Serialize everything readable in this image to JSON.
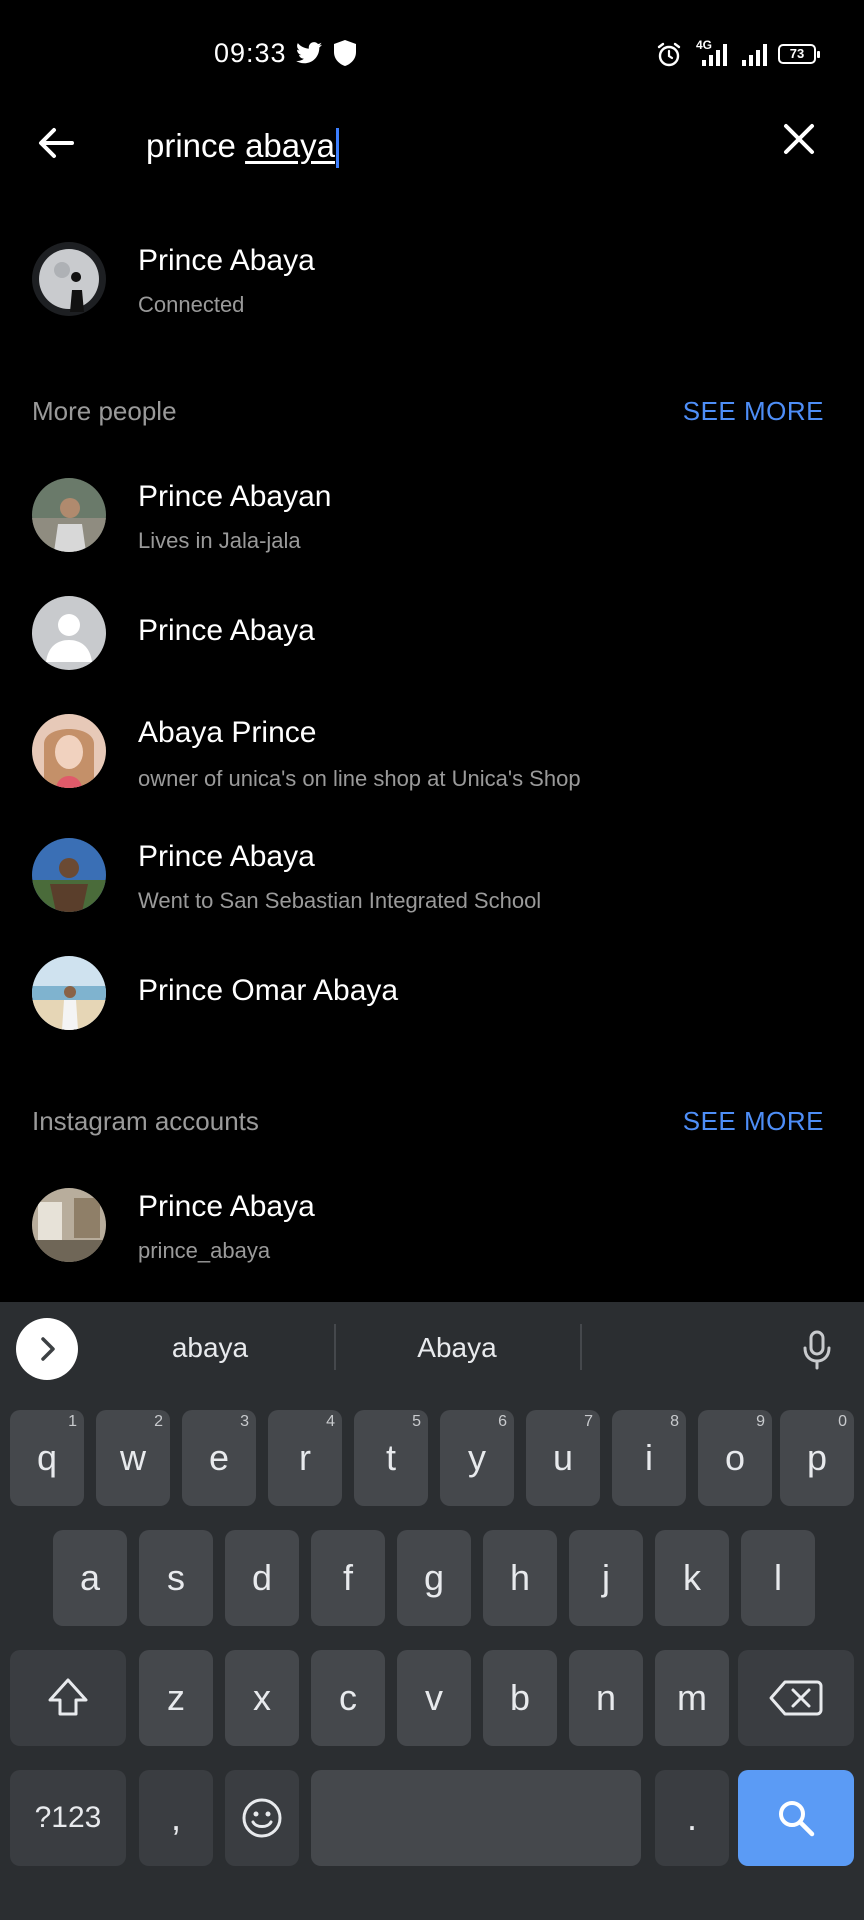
{
  "status_bar": {
    "time": "09:33",
    "network": "4G",
    "battery": "73"
  },
  "search": {
    "value_plain": "prince ",
    "value_typed": "abaya"
  },
  "top_result": {
    "name": "Prince Abaya",
    "subtitle": "Connected"
  },
  "more_people": {
    "title": "More people",
    "see_more": "SEE MORE",
    "items": [
      {
        "name": "Prince Abayan",
        "subtitle": "Lives in Jala-jala"
      },
      {
        "name": "Prince Abaya",
        "subtitle": ""
      },
      {
        "name": "Abaya Prince",
        "subtitle": "owner of unica's on line shop at Unica's Shop"
      },
      {
        "name": "Prince Abaya",
        "subtitle": "Went to San Sebastian Integrated School"
      },
      {
        "name": "Prince Omar Abaya",
        "subtitle": ""
      }
    ]
  },
  "instagram": {
    "title": "Instagram accounts",
    "see_more": "SEE MORE",
    "items": [
      {
        "name": "Prince Abaya",
        "subtitle": "prince_abaya"
      }
    ]
  },
  "keyboard": {
    "suggestions": [
      "abaya",
      "Abaya"
    ],
    "row1": [
      {
        "k": "q",
        "h": "1"
      },
      {
        "k": "w",
        "h": "2"
      },
      {
        "k": "e",
        "h": "3"
      },
      {
        "k": "r",
        "h": "4"
      },
      {
        "k": "t",
        "h": "5"
      },
      {
        "k": "y",
        "h": "6"
      },
      {
        "k": "u",
        "h": "7"
      },
      {
        "k": "i",
        "h": "8"
      },
      {
        "k": "o",
        "h": "9"
      },
      {
        "k": "p",
        "h": "0"
      }
    ],
    "row2": [
      "a",
      "s",
      "d",
      "f",
      "g",
      "h",
      "j",
      "k",
      "l"
    ],
    "row3": [
      "z",
      "x",
      "c",
      "v",
      "b",
      "n",
      "m"
    ],
    "symbols_label": "?123",
    "comma": ",",
    "period": "."
  },
  "colors": {
    "accent": "#4e8ef7",
    "caret": "#3d7fff",
    "search_key": "#5b9bf5"
  }
}
